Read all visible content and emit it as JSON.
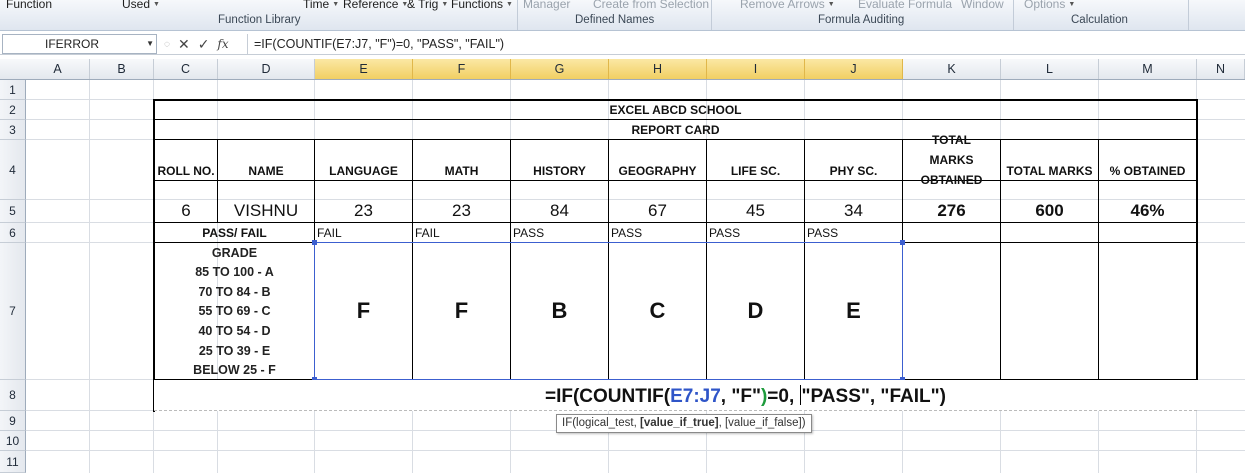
{
  "ribbon": {
    "items": [
      {
        "label": "Function",
        "dim": false,
        "caret": false
      },
      {
        "label": "Used",
        "dim": false,
        "caret": true
      },
      {
        "label": "Time",
        "dim": false,
        "caret": true
      },
      {
        "label": "Reference",
        "dim": false,
        "caret": true
      },
      {
        "label": "& Trig",
        "dim": false,
        "caret": true
      },
      {
        "label": "Functions",
        "dim": false,
        "caret": true
      },
      {
        "label": "Manager",
        "dim": true,
        "caret": false
      },
      {
        "label": "Create from Selection",
        "dim": true,
        "caret": false
      },
      {
        "label": "Remove Arrows",
        "dim": true,
        "caret": true
      },
      {
        "label": "Evaluate Formula",
        "dim": true,
        "caret": false
      },
      {
        "label": "Window",
        "dim": true,
        "caret": false
      },
      {
        "label": "Options",
        "dim": true,
        "caret": true
      }
    ],
    "groups": [
      "Function Library",
      "Defined Names",
      "Formula Auditing",
      "Calculation"
    ]
  },
  "formula_bar": {
    "name_box": "IFERROR",
    "cancel_icon": "✕",
    "enter_icon": "✓",
    "fx_label": "fx",
    "formula": "=IF(COUNTIF(E7:J7, \"F\")=0, \"PASS\", \"FAIL\")"
  },
  "columns": [
    "A",
    "B",
    "C",
    "D",
    "E",
    "F",
    "G",
    "H",
    "I",
    "J",
    "K",
    "L",
    "M",
    "N"
  ],
  "rows": [
    "1",
    "2",
    "3",
    "4",
    "5",
    "6",
    "7",
    "8",
    "9",
    "10",
    "11"
  ],
  "report": {
    "school": "EXCEL ABCD SCHOOL",
    "card_title": "REPORT CARD",
    "headers": [
      "ROLL NO.",
      "NAME",
      "LANGUAGE",
      "MATH",
      "HISTORY",
      "GEOGRAPHY",
      "LIFE SC.",
      "PHY SC.",
      "TOTAL MARKS OBTAINED",
      "TOTAL MARKS",
      "% OBTAINED"
    ],
    "roll_no": "6",
    "name": "VISHNU",
    "marks": [
      "23",
      "23",
      "84",
      "67",
      "45",
      "34"
    ],
    "total_obtained": "276",
    "total_marks": "600",
    "percent": "46%",
    "pass_fail_label": "PASS/ FAIL",
    "pass_fail": [
      "FAIL",
      "FAIL",
      "PASS",
      "PASS",
      "PASS",
      "PASS"
    ],
    "grade_title": "GRADE",
    "grade_ranges": [
      "85 TO 100 - A",
      "70 TO 84 - B",
      "55 TO 69 - C",
      "40 TO 54 - D",
      "25 TO 39 - E",
      "BELOW 25 - F"
    ],
    "grades": [
      "F",
      "F",
      "B",
      "C",
      "D",
      "E"
    ]
  },
  "edit_cell": {
    "prefix": "=IF(COUNTIF(",
    "range_ref": "E7:J7",
    "middle": ", \"F\"",
    "close_paren": ")",
    "suffix_1": "=0, ",
    "suffix_2": "\"PASS\", \"FAIL\")"
  },
  "tooltip": {
    "fn": "IF(logical_test, ",
    "current_arg": "[value_if_true]",
    "rest": ", [value_if_false])"
  },
  "colors": {
    "range_ref": "#2f55c8",
    "paren_highlight": "#1e9b3c",
    "selected_column": "#f1cf63"
  }
}
